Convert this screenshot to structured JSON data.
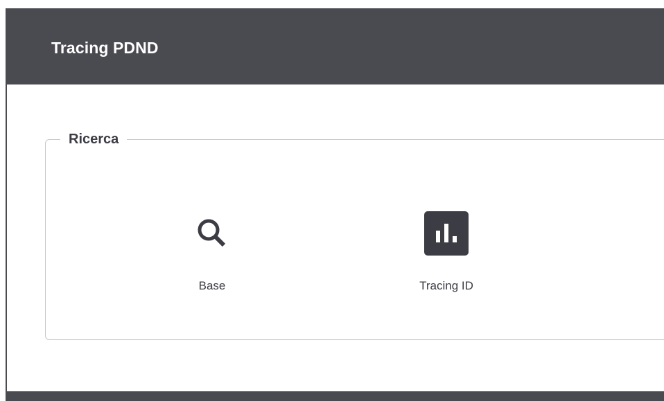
{
  "header": {
    "title": "Tracing PDND"
  },
  "section": {
    "legend": "Ricerca",
    "items": [
      {
        "label": "Base",
        "icon": "search-icon"
      },
      {
        "label": "Tracing ID",
        "icon": "bar-chart-icon"
      }
    ]
  },
  "colors": {
    "header_bg": "#4a4a51",
    "text": "#3c3c44",
    "border": "#c8c8c8"
  }
}
